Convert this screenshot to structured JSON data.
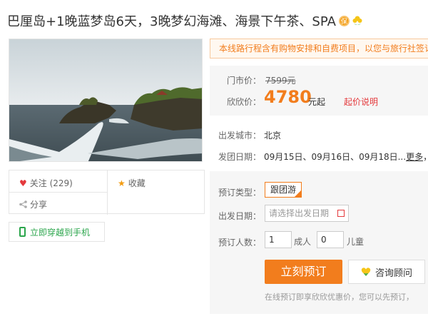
{
  "title": {
    "text": "巴厘岛+1晚蓝梦岛6天，3晚梦幻海滩、海景下午茶、SPA"
  },
  "actions": {
    "like_label": "关注 (229)",
    "fav_label": "收藏",
    "share_label": "分享",
    "mobile_label": "立即穿越到手机"
  },
  "notice": "本线路行程含有购物安排和自费项目，以您与旅行社签订",
  "price": {
    "market_label": "门市价：",
    "market_value": "7599元",
    "our_label": "欣欣价：",
    "our_value": "4780",
    "unit": "元起",
    "note": "起价说明"
  },
  "info": {
    "city_label": "出发城市：",
    "city_value": "北京",
    "dates_label": "发团日期：",
    "dates_value": "09月15日、09月16日、09月18日...",
    "more": "更多",
    "dates_tail": "，请"
  },
  "booking": {
    "type_label": "预订类型：",
    "type_value": "跟团游",
    "date_label": "出发日期：",
    "date_placeholder": "请选择出发日期",
    "people_label": "预订人数：",
    "adults_value": "1",
    "adults_unit": "成人",
    "children_value": "0",
    "children_unit": "儿童",
    "book_button": "立刻预订",
    "consult_button": "咨询顾问",
    "footer": "在线预订即享欣欣优惠价，您可以先预订，"
  },
  "colors": {
    "accent": "#f27d1d",
    "red": "#e4393c",
    "green": "#2aa54b"
  }
}
